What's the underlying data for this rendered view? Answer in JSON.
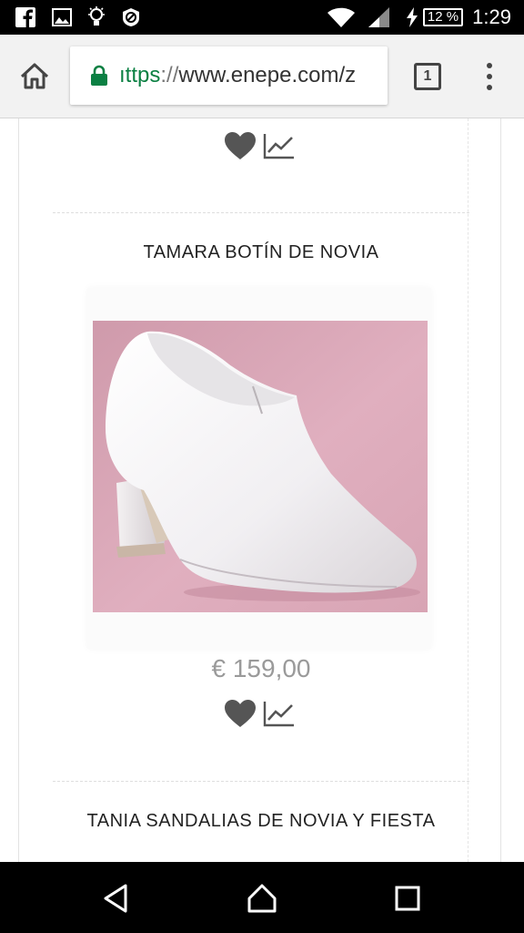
{
  "status_bar": {
    "icons_left": [
      "facebook-icon",
      "image-icon",
      "bulb-icon",
      "block-icon"
    ],
    "icons_right": [
      "wifi-icon",
      "signal-icon",
      "charging-icon"
    ],
    "battery": "12 %",
    "time": "1:29"
  },
  "browser": {
    "url_scheme": "ıttps",
    "url_separator": "://",
    "url_host": "www.enepe.com/z",
    "tab_count": "1",
    "secure_color": "#0b8043"
  },
  "products": [
    {
      "title": "TAMARA BOTÍN DE NOVIA",
      "price": "€ 159,00"
    },
    {
      "title": "TANIA SANDALIAS DE NOVIA Y FIESTA"
    }
  ],
  "colors": {
    "price": "#9a9a9a",
    "image_background": "#dba7b7",
    "icon_gray": "#555555"
  }
}
